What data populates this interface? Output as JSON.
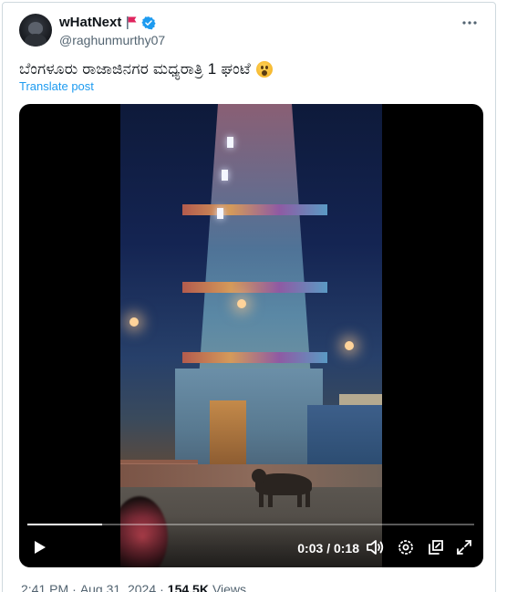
{
  "author": {
    "display_name": "wHatNext",
    "handle": "@raghunmurthy07",
    "verified_color": "#1d9bf0",
    "flag_color": "#e0245e"
  },
  "tweet": {
    "text": "ಬೆಂಗಳೂರು ರಾಜಾಜಿನಗರ ಮಧ್ಯರಾತ್ರಿ 1 ಘಂಟೆ",
    "emoji": "astonished-face",
    "translate_label": "Translate post"
  },
  "video": {
    "time_current": "0:03",
    "time_separator": "/",
    "time_total": "0:18",
    "progress_fraction": 0.1667,
    "icons": [
      "play-icon",
      "volume-icon",
      "settings-icon",
      "picture-in-picture-icon",
      "fullscreen-icon"
    ]
  },
  "meta": {
    "time": "2:41 PM",
    "dot1": "·",
    "date": "Aug 31, 2024",
    "dot2": "·",
    "views_count": "154.5K",
    "views_label": "Views"
  },
  "colors": {
    "accent": "#1d9bf0",
    "text_primary": "#0f1419",
    "text_secondary": "#536471"
  }
}
